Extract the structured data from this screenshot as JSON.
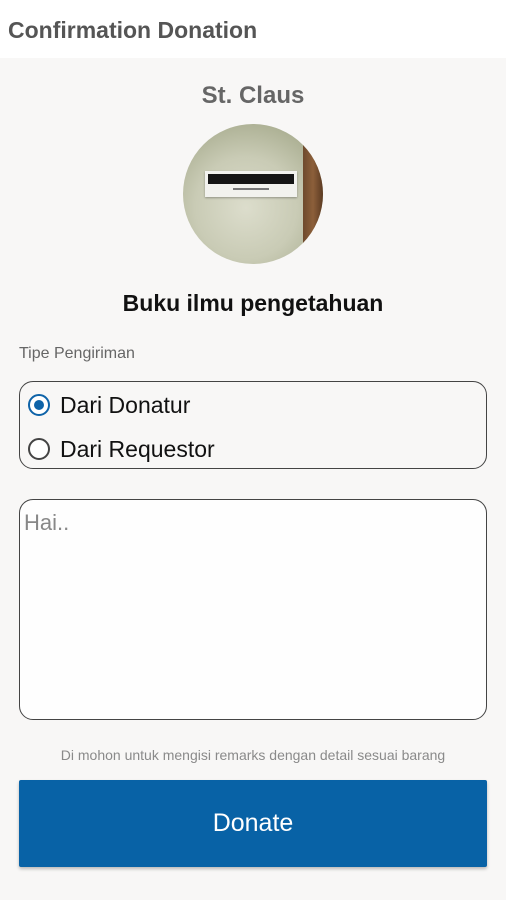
{
  "header": {
    "title": "Confirmation Donation"
  },
  "recipient": {
    "name": "St. Claus"
  },
  "item": {
    "title": "Buku ilmu pengetahuan"
  },
  "shipping": {
    "label": "Tipe Pengiriman",
    "options": [
      {
        "label": "Dari Donatur",
        "checked": true
      },
      {
        "label": "Dari Requestor",
        "checked": false
      }
    ]
  },
  "remarks": {
    "placeholder": "Hai..",
    "value": ""
  },
  "hint": "Di mohon untuk mengisi remarks dengan detail sesuai barang",
  "actions": {
    "donate_label": "Donate"
  },
  "colors": {
    "accent": "#0862a6",
    "background": "#f8f7f6"
  }
}
